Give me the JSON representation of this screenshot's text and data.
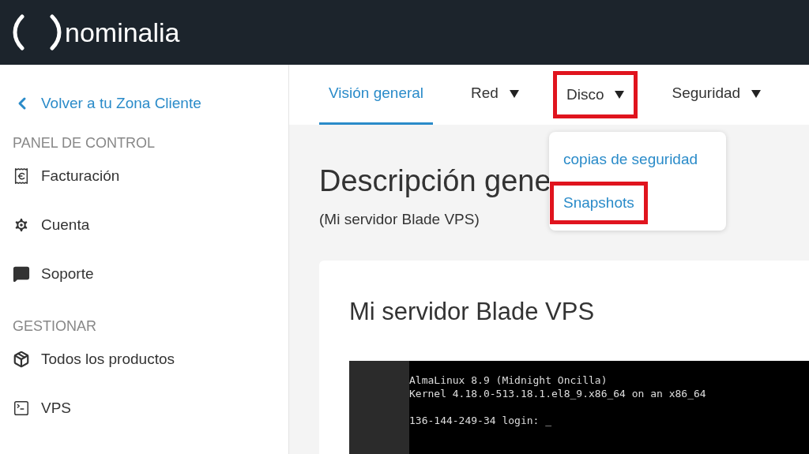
{
  "header": {
    "logo_text": "nominalia"
  },
  "sidebar": {
    "back_link": "Volver a tu Zona Cliente",
    "sections": [
      {
        "title": "PANEL DE CONTROL",
        "items": [
          {
            "kind": "invoice",
            "label": "Facturación"
          },
          {
            "kind": "gear",
            "label": "Cuenta"
          },
          {
            "kind": "chat",
            "label": "Soporte"
          }
        ]
      },
      {
        "title": "GESTIONAR",
        "items": [
          {
            "kind": "box",
            "label": "Todos los productos"
          },
          {
            "kind": "terminal",
            "label": "VPS"
          }
        ]
      }
    ]
  },
  "tabs": [
    {
      "label": "Visión general",
      "selected": true,
      "dropdown": false,
      "highlighted": false
    },
    {
      "label": "Red",
      "selected": false,
      "dropdown": true,
      "highlighted": false
    },
    {
      "label": "Disco",
      "selected": false,
      "dropdown": true,
      "highlighted": true
    },
    {
      "label": "Seguridad",
      "selected": false,
      "dropdown": true,
      "highlighted": false
    }
  ],
  "dropdown_menu": {
    "items": [
      {
        "label": "copias de seguridad",
        "highlighted": false
      },
      {
        "label": "Snapshots",
        "highlighted": true
      }
    ]
  },
  "page": {
    "title": "Descripción gene",
    "subtitle": "(Mi servidor Blade VPS)"
  },
  "card": {
    "title": "Mi servidor Blade VPS",
    "console_blocks": [
      [
        "AlmaLinux 8.9 (Midnight Oncilla)",
        "Kernel 4.18.0-513.18.1.el8_9.x86_64 on an x86_64"
      ],
      [
        "136-144-249-34 login: _"
      ]
    ]
  }
}
